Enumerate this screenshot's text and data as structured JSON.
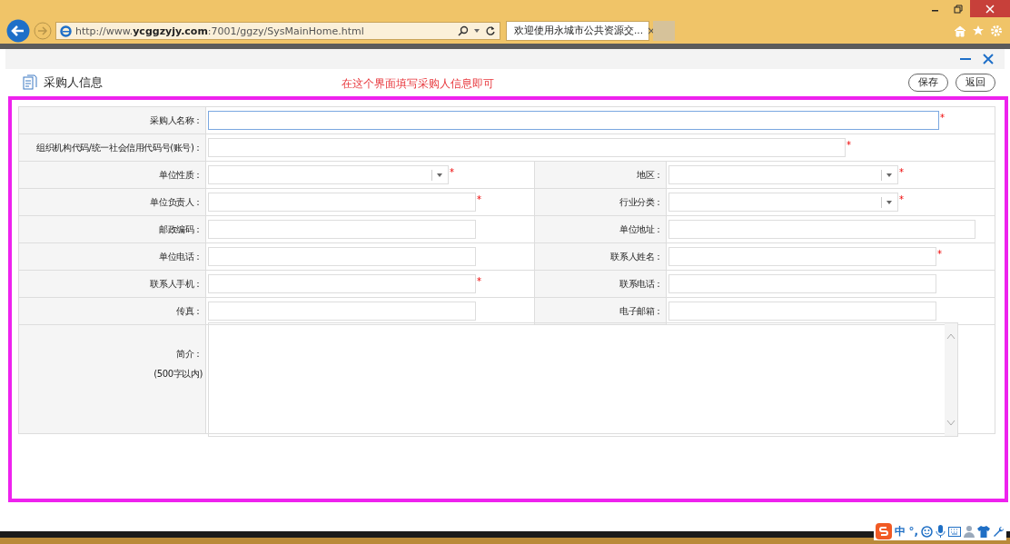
{
  "browser": {
    "address": "http://www.**ycggzyjy.com**:7001/ggzy/SysMainHome.html",
    "tab": {
      "title": "欢迎使用永城市公共资源交...",
      "close": "×"
    }
  },
  "panel": {
    "title": "采购人信息",
    "note": "在这个界面填写采购人信息即可",
    "buttons": [
      "保存",
      "返回"
    ]
  },
  "form": {
    "rows": [
      {
        "kind": "full",
        "label": "采购人名称：",
        "field": {
          "kind": "text",
          "focused": true,
          "required_mark": "*"
        }
      },
      {
        "kind": "full",
        "label": "组织机构代码/统一社会信用代码号(账号)：",
        "field": {
          "kind": "text",
          "required_mark": "*"
        }
      },
      {
        "kind": "pair",
        "cells": [
          {
            "label": "单位性质：",
            "field": {
              "kind": "select",
              "required_mark": "*"
            }
          },
          {
            "label": "地区：",
            "field": {
              "kind": "select",
              "required_mark": "*"
            }
          }
        ]
      },
      {
        "kind": "pair",
        "cells": [
          {
            "label": "单位负责人：",
            "field": {
              "kind": "text",
              "required_mark": "*"
            }
          },
          {
            "label": "行业分类：",
            "field": {
              "kind": "select",
              "required_mark": "*"
            }
          }
        ]
      },
      {
        "kind": "pair",
        "cells": [
          {
            "label": "邮政编码：",
            "field": {
              "kind": "text"
            }
          },
          {
            "label": "单位地址：",
            "field": {
              "kind": "wide"
            }
          }
        ]
      },
      {
        "kind": "pair",
        "cells": [
          {
            "label": "单位电话：",
            "field": {
              "kind": "text"
            }
          },
          {
            "label": "联系人姓名：",
            "field": {
              "kind": "text",
              "required_mark": "*"
            }
          }
        ]
      },
      {
        "kind": "pair",
        "cells": [
          {
            "label": "联系人手机：",
            "field": {
              "kind": "text",
              "required_mark": "*"
            }
          },
          {
            "label": "联系电话：",
            "field": {
              "kind": "text"
            }
          }
        ]
      },
      {
        "kind": "pair",
        "cells": [
          {
            "label": "传真：",
            "field": {
              "kind": "text"
            }
          },
          {
            "label": "电子邮箱：",
            "field": {
              "kind": "text"
            }
          }
        ]
      },
      {
        "kind": "textarea",
        "label": "简介：",
        "hint": "(500字以内)"
      }
    ]
  },
  "ime": {
    "mode": "中",
    "punct": "°,"
  }
}
